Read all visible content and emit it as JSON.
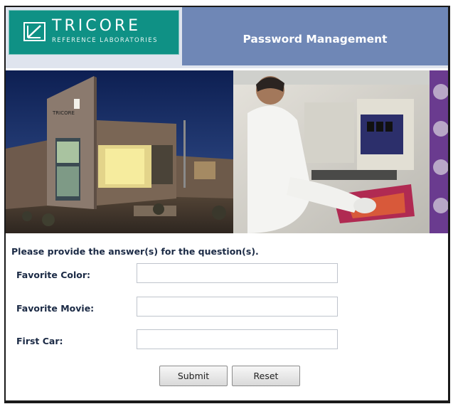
{
  "header": {
    "logo": {
      "name": "TRICORE",
      "subtitle": "REFERENCE LABORATORIES",
      "background_color": "#0f9185"
    },
    "title": "Password Management",
    "title_bar_color": "#6f87b6"
  },
  "banner": {
    "left_photo": "laboratory-building-at-night",
    "right_photo": "scientist-at-computer",
    "building_sign": "TRICORE"
  },
  "form": {
    "instruction": "Please provide the answer(s) for the question(s).",
    "questions": [
      {
        "label": "Favorite Color:",
        "value": ""
      },
      {
        "label": "Favorite Movie:",
        "value": ""
      },
      {
        "label": "First Car:",
        "value": ""
      }
    ],
    "submit_label": "Submit",
    "reset_label": "Reset"
  }
}
